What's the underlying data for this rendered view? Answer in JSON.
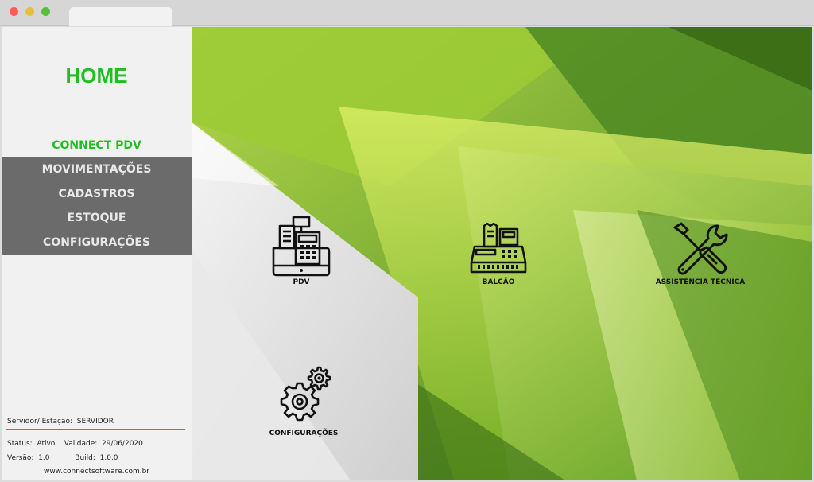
{
  "sidebar": {
    "title": "HOME",
    "menu": [
      {
        "label": "CONNECT PDV"
      },
      {
        "label": "MOVIMENTAÇÕES"
      },
      {
        "label": "CADASTROS"
      },
      {
        "label": "ESTOQUE"
      },
      {
        "label": "CONFIGURAÇÕES"
      }
    ],
    "server_label": "Servidor/ Estação:",
    "server_value": "SERVIDOR",
    "status_label": "Status:",
    "status_value": "Ativo",
    "validity_label": "Validade:",
    "validity_value": "29/06/2020",
    "version_label": "Versão:",
    "version_value": "1.0",
    "build_label": "Build:",
    "build_value": "1.0.0",
    "website": "www.connectsoftware.com.br"
  },
  "tiles": [
    {
      "label": "PDV",
      "icon": "cash-register-icon"
    },
    {
      "label": "BALCÃO",
      "icon": "receipt-register-icon"
    },
    {
      "label": "ASSISTÊNCIA TÉCNICA",
      "icon": "wrench-screwdriver-icon"
    },
    {
      "label": "CONFIGURAÇÕES",
      "icon": "gears-icon"
    }
  ],
  "colors": {
    "accent": "#1fbf1f",
    "menu_bg": "#6b6b6b",
    "menu_text": "#e8e8e8"
  }
}
